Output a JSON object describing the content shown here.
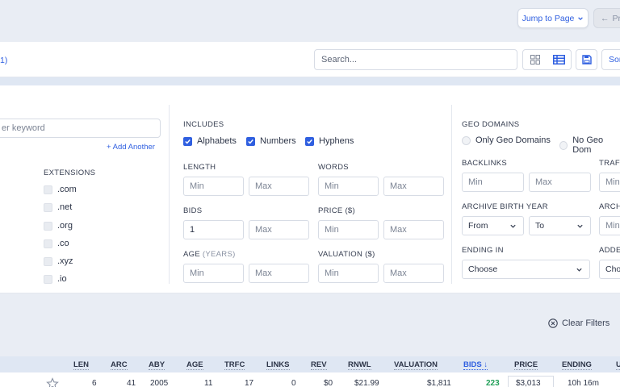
{
  "topbar": {
    "jump_label": "Jump to Page",
    "prev_label": "Pre"
  },
  "toolbar": {
    "count_label": "1)",
    "search_placeholder": "Search...",
    "sort_label": "Sor"
  },
  "filters": {
    "keyword_placeholder": "er keyword",
    "add_another": "+ Add Another",
    "extensions": {
      "label": "EXTENSIONS",
      "items": [
        ".com",
        ".net",
        ".org",
        ".co",
        ".xyz",
        ".io"
      ]
    },
    "includes": {
      "label": "INCLUDES",
      "items": [
        {
          "label": "Alphabets",
          "checked": true
        },
        {
          "label": "Numbers",
          "checked": true
        },
        {
          "label": "Hyphens",
          "checked": true
        }
      ]
    },
    "length": {
      "label": "LENGTH",
      "min_placeholder": "Min",
      "max_placeholder": "Max"
    },
    "words": {
      "label": "WORDS",
      "min_placeholder": "Min",
      "max_placeholder": "Max"
    },
    "bids": {
      "label": "BIDS",
      "min_value": "1",
      "max_placeholder": "Max"
    },
    "price": {
      "label": "PRICE ($)",
      "min_placeholder": "Min",
      "max_placeholder": "Max"
    },
    "age": {
      "label": "AGE",
      "label_suffix": "(YEARS)",
      "min_placeholder": "Min",
      "max_placeholder": "Max"
    },
    "valuation": {
      "label": "VALUATION ($)",
      "min_placeholder": "Min",
      "max_placeholder": "Max"
    },
    "geo": {
      "label": "GEO DOMAINS",
      "options": [
        "Only Geo Domains",
        "No Geo Dom"
      ]
    },
    "backlinks": {
      "label": "BACKLINKS",
      "min_placeholder": "Min",
      "max_placeholder": "Max"
    },
    "traffic": {
      "label": "TRAFI",
      "min_placeholder": "Min"
    },
    "archive": {
      "label": "ARCHIVE BIRTH YEAR",
      "from": "From",
      "to": "To"
    },
    "arch2": {
      "label": "ARCH",
      "min_placeholder": "Min"
    },
    "ending": {
      "label": "ENDING IN",
      "value": "Choose"
    },
    "added": {
      "label": "ADDE",
      "value": "Choo"
    },
    "clear_label": "Clear Filters"
  },
  "table": {
    "headers": [
      "LEN",
      "ARC",
      "ABY",
      "AGE",
      "TRFC",
      "LINKS",
      "REV",
      "RNWL",
      "VALUATION",
      "BIDS",
      "PRICE",
      "ENDING",
      "U"
    ],
    "row": [
      "6",
      "41",
      "2005",
      "11",
      "17",
      "0",
      "$0",
      "$21.99",
      "$1,811",
      "223",
      "$3,013",
      "10h 16m"
    ]
  },
  "colors": {
    "accent": "#2f5fe0",
    "bids_green": "#23a05a",
    "header_bg": "#dfe7f3"
  }
}
